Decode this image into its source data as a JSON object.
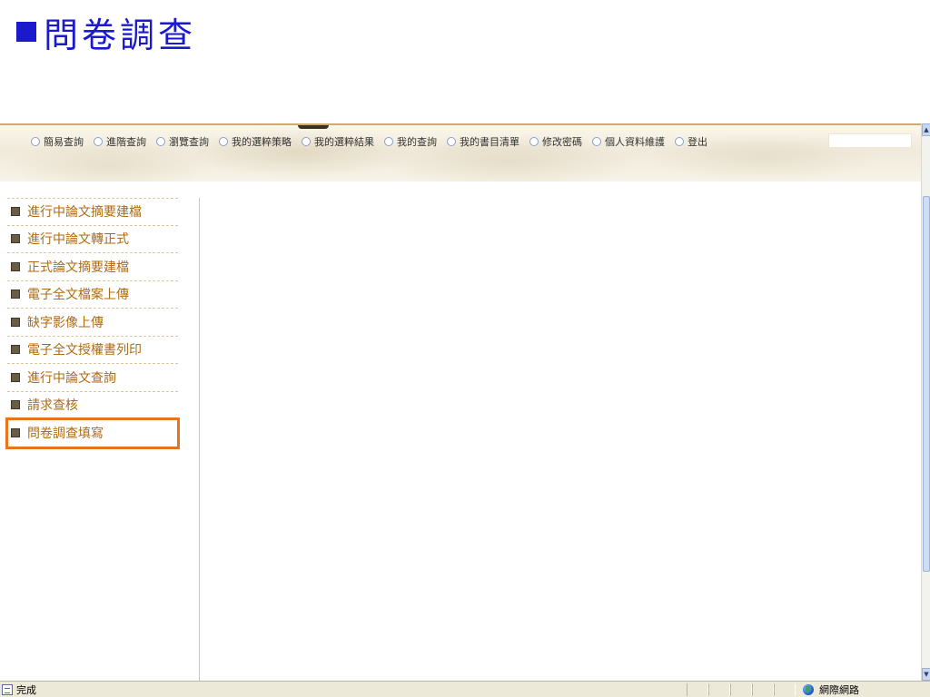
{
  "slide": {
    "title": "問卷調查"
  },
  "nav": {
    "items": [
      {
        "label": "簡易查詢"
      },
      {
        "label": "進階查詢"
      },
      {
        "label": "瀏覽查詢"
      },
      {
        "label": "我的選粹策略"
      },
      {
        "label": "我的選粹結果"
      },
      {
        "label": "我的查詢"
      },
      {
        "label": "我的書目清單"
      },
      {
        "label": "修改密碼"
      },
      {
        "label": "個人資料維護"
      },
      {
        "label": "登出"
      }
    ]
  },
  "menu": {
    "items": [
      {
        "label": "進行中論文摘要建檔"
      },
      {
        "label": "進行中論文轉正式"
      },
      {
        "label": "正式論文摘要建檔"
      },
      {
        "label": "電子全文檔案上傳"
      },
      {
        "label": "缺字影像上傳"
      },
      {
        "label": "電子全文授權書列印"
      },
      {
        "label": "進行中論文查詢"
      },
      {
        "label": "請求查核"
      },
      {
        "label": "問卷調查填寫"
      }
    ],
    "selected_index": 8
  },
  "status": {
    "text": "完成",
    "zone": "網際網路"
  },
  "colors": {
    "title_blue": "#1a1acc",
    "menu_text": "#b06a10",
    "highlight": "#e8741e"
  },
  "icons": {
    "title_bullet": "filled-square",
    "nav_item": "circle-radio",
    "menu_bullet": "filled-square",
    "status_page": "page-icon",
    "status_zone": "globe-icon"
  }
}
